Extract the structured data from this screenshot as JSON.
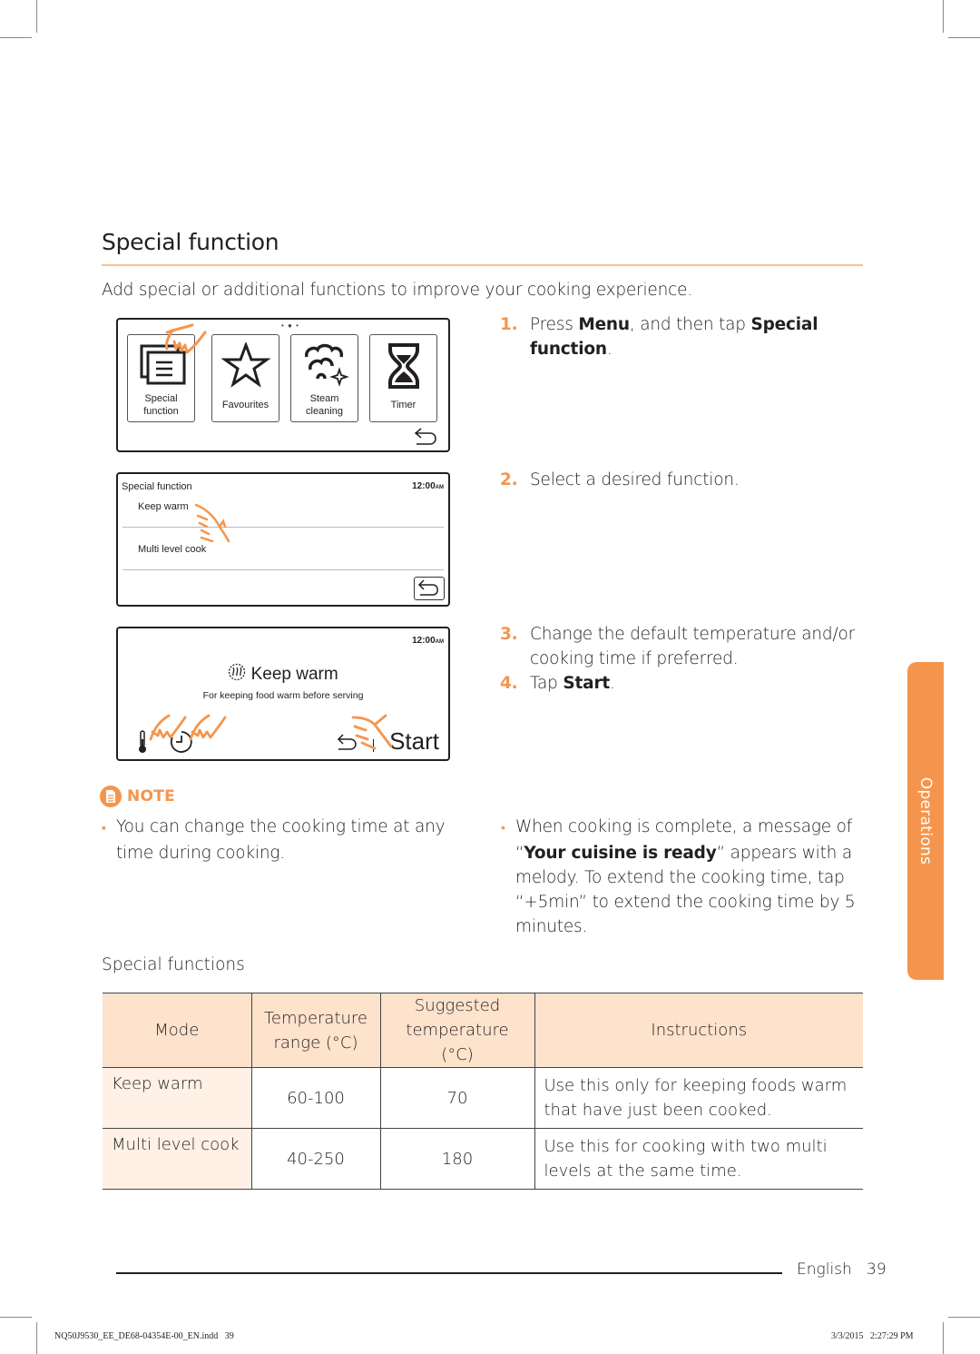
{
  "page": {
    "title": "Special function",
    "intro": "Add special or additional functions to improve your cooking experience.",
    "side_tab": "Operations",
    "footer_lang": "English",
    "page_number": "39",
    "slug_file": "NQ50J9530_EE_DE68-04354E-00_EN.indd   39",
    "slug_date": "3/3/2015   2:27:29 PM"
  },
  "screen1": {
    "page_dots": "• ● •",
    "tiles": [
      {
        "label_1": "Special",
        "label_2": "function",
        "icon": "special-function-icon"
      },
      {
        "label_1": "Favourites",
        "label_2": "",
        "icon": "star-icon"
      },
      {
        "label_1": "Steam",
        "label_2": "cleaning",
        "icon": "steam-icon"
      },
      {
        "label_1": "Timer",
        "label_2": "",
        "icon": "hourglass-icon"
      }
    ]
  },
  "screen2": {
    "header": "Special function",
    "time": "12:00",
    "ampm": "AM",
    "items": [
      "Keep warm",
      "Multi level cook"
    ]
  },
  "screen3": {
    "time": "12:00",
    "ampm": "AM",
    "title": "Keep warm",
    "subtitle": "For keeping food warm before serving",
    "start": "Start"
  },
  "steps": [
    {
      "num": "1.",
      "pre": "Press ",
      "b1": "Menu",
      "mid": ", and then tap ",
      "b2": "Special",
      "line2_b": "function",
      "line2_post": "."
    },
    {
      "num": "2.",
      "text": "Select a desired function."
    },
    {
      "num": "3.",
      "line1": "Change the default temperature and/or",
      "line2": "cooking time if preferred."
    },
    {
      "num": "4.",
      "pre": "Tap ",
      "b": "Start",
      "post": "."
    }
  ],
  "note": {
    "label": "NOTE",
    "left": {
      "line1": "You can change the cooking time at any",
      "line2": "time during cooking."
    },
    "right": {
      "line1": "When cooking is complete, a message of",
      "line2_open": "“",
      "line2_b": "Your cuisine is ready",
      "line2_post": "” appears with a",
      "line3": "melody. To extend the cooking time, tap",
      "line4": "“+5min” to extend the cooking time by 5",
      "line5": "minutes."
    }
  },
  "table": {
    "caption": "Special functions",
    "headers": {
      "mode": "Mode",
      "range_1": "Temperature",
      "range_2": "range (°C)",
      "sugg_1": "Suggested",
      "sugg_2": "temperature (°C)",
      "instructions": "Instructions"
    },
    "rows": [
      {
        "mode": "Keep warm",
        "range": "60-100",
        "suggested": "70",
        "ins_1": "Use this only for keeping foods warm",
        "ins_2": "that have just been cooked."
      },
      {
        "mode": "Multi level cook",
        "range": "40-250",
        "suggested": "180",
        "ins_1": "Use this for cooking with two multi",
        "ins_2": "levels at the same time."
      }
    ]
  },
  "colors": {
    "accent": "#f5954d",
    "title_rule": "#f9c184",
    "table_header_bg": "#fde2cc",
    "table_mode_bg": "#fff1e6"
  }
}
